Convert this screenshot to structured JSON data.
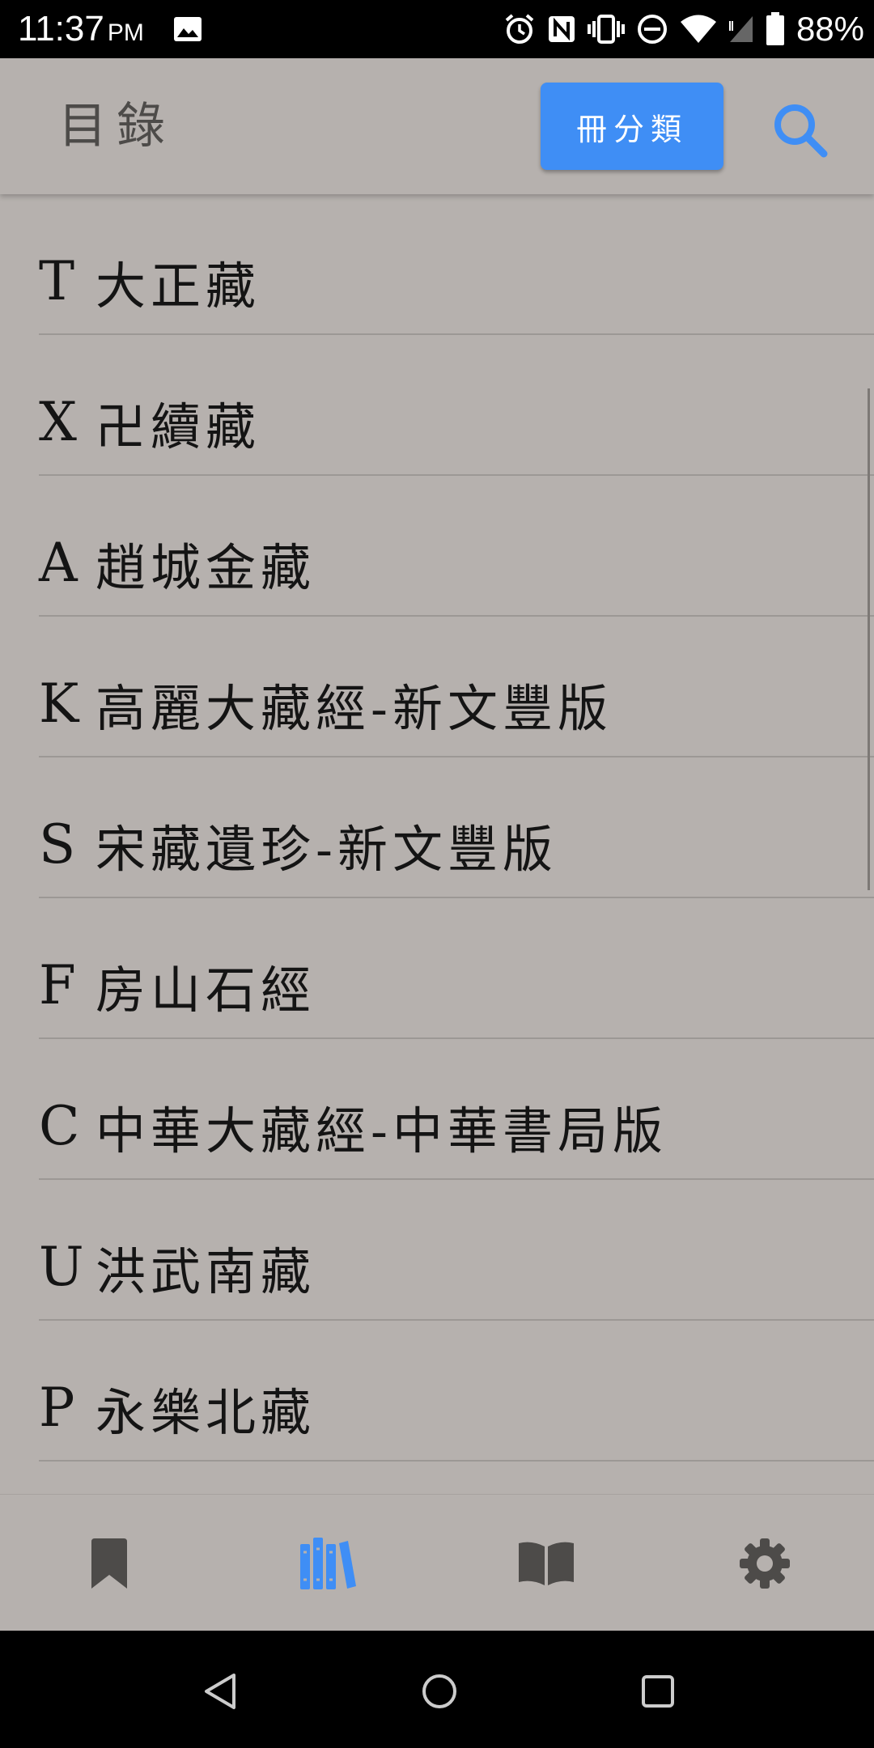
{
  "status_bar": {
    "time": "11:37",
    "ampm": "PM",
    "battery": "88%"
  },
  "app_bar": {
    "title": "目錄",
    "classify_button": "冊分類",
    "search_icon": "search-icon"
  },
  "colors": {
    "background": "#b6b1ae",
    "accent": "#3f8ef5",
    "text": "#141414"
  },
  "catalog": [
    {
      "code": "T",
      "name": "大正藏"
    },
    {
      "code": "X",
      "name": "卍續藏"
    },
    {
      "code": "A",
      "name": "趙城金藏"
    },
    {
      "code": "K",
      "name": "高麗大藏經-新文豐版"
    },
    {
      "code": "S",
      "name": "宋藏遺珍-新文豐版"
    },
    {
      "code": "F",
      "name": "房山石經"
    },
    {
      "code": "C",
      "name": "中華大藏經-中華書局版"
    },
    {
      "code": "U",
      "name": "洪武南藏"
    },
    {
      "code": "P",
      "name": "永樂北藏"
    }
  ],
  "bottom_nav": [
    {
      "icon": "bookmark-icon",
      "active": false
    },
    {
      "icon": "library-icon",
      "active": true
    },
    {
      "icon": "book-icon",
      "active": false
    },
    {
      "icon": "settings-icon",
      "active": false
    }
  ],
  "system_nav": [
    "back-icon",
    "home-icon",
    "recents-icon"
  ]
}
